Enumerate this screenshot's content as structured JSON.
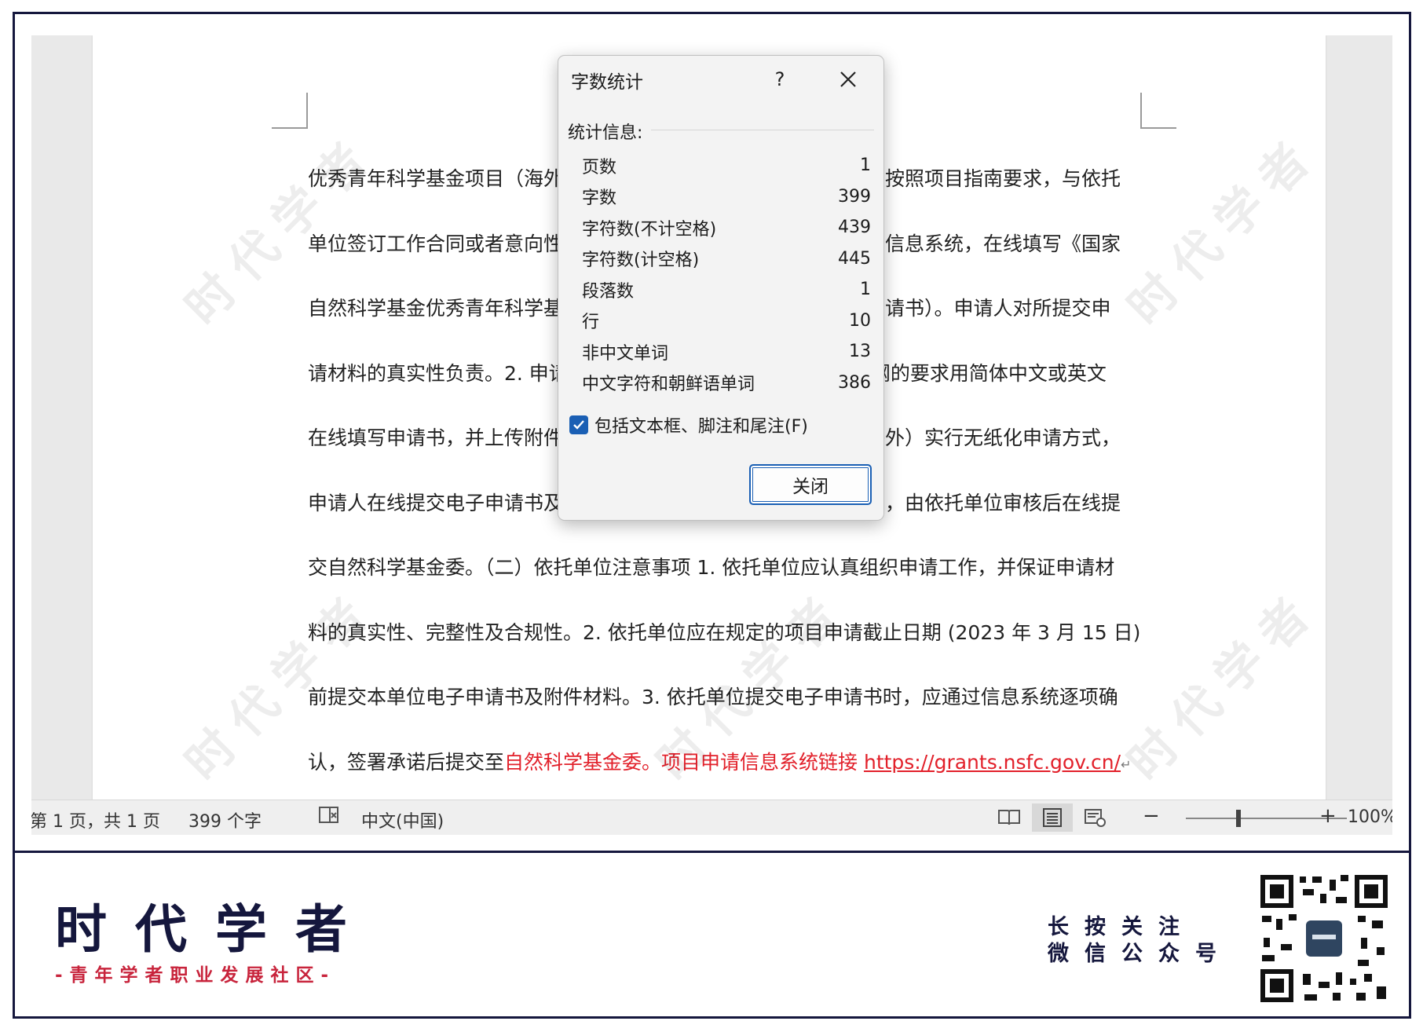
{
  "document": {
    "lines": [
      "优秀青年科学基金项目（海外）",
      "可按照项目指南要求，与依托",
      "单位签订工作合同或者意向性协",
      "录信息系统，在线填写《国家",
      "自然科学基金优秀青年科学基金",
      "申请书）。申请人对所提交申",
      "请材料的真实性负责。2. 申请",
      "提纲的要求用简体中文或英文",
      "在线填写申请书，并上传附件等",
      "海外）实行无纸化申请方式，",
      "申请人在线提交电子申请书及附",
      "位，由依托单位审核后在线提",
      "交自然科学基金委。（二）依托单位注意事项 1. 依托单位应认真组织申请工作，并保证申请材",
      "料的真实性、完整性及合规性。2. 依托单位应在规定的项目申请截止日期 (2023 年 3 月 15 日)",
      "前提交本单位电子申请书及附件材料。3. 依托单位提交电子申请书时，应通过信息系统逐项确",
      "认，签署承诺后提交至"
    ],
    "red_text": "自然科学基金委。项目申请信息系统链接 ",
    "link_text": "https://grants.nsfc.gov.cn/",
    "return_mark": "↵",
    "watermark": "时代学者"
  },
  "statusbar": {
    "page": "第 1 页，共 1 页",
    "words": "399 个字",
    "language": "中文(中国)",
    "zoom_minus": "−",
    "zoom_plus": "+",
    "zoom": "100%"
  },
  "dialog": {
    "title": "字数统计",
    "help": "?",
    "section": "统计信息:",
    "stats": [
      {
        "label": "页数",
        "value": "1"
      },
      {
        "label": "字数",
        "value": "399"
      },
      {
        "label": "字符数(不计空格)",
        "value": "439"
      },
      {
        "label": "字符数(计空格)",
        "value": "445"
      },
      {
        "label": "段落数",
        "value": "1"
      },
      {
        "label": "行",
        "value": "10"
      },
      {
        "label": "非中文单词",
        "value": "13"
      },
      {
        "label": "中文字符和朝鲜语单词",
        "value": "386"
      }
    ],
    "checkbox_label": "包括文本框、脚注和尾注(F)",
    "checkbox_checked": true,
    "close_button": "关闭"
  },
  "branding": {
    "title": "时代学者",
    "subtitle": "-青年学者职业发展社区-",
    "follow_line1": "长按关注",
    "follow_line2": "微信公众号"
  },
  "colors": {
    "navy": "#15173d",
    "accent_red": "#c8243c",
    "link_red": "#e2202a",
    "word_blue": "#1a5fb4"
  }
}
